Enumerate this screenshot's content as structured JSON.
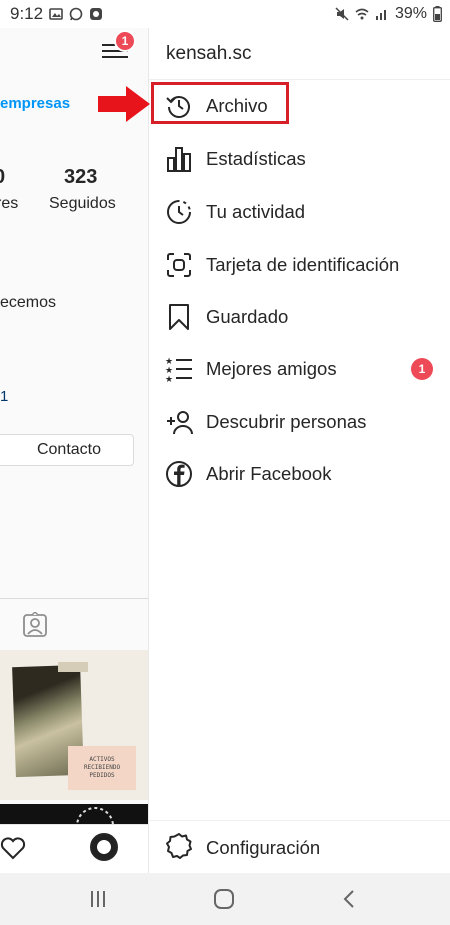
{
  "status_bar": {
    "time": "9:12",
    "battery": "39%",
    "left_icons": [
      "gallery-icon",
      "whatsapp-icon",
      "camera-app-icon"
    ],
    "right_icons": [
      "mute-icon",
      "wifi-icon",
      "signal-icon",
      "battery-icon"
    ]
  },
  "profile_bg": {
    "notification_count": "1",
    "business_link": "empresas",
    "stats": [
      {
        "number": "0",
        "label": "res"
      },
      {
        "number": "323",
        "label": "Seguidos"
      }
    ],
    "bio_fragment": "ecemos",
    "link_fragment": "1",
    "contact_button": "Contacto",
    "post_card_lines": [
      "ACTIVOS",
      "RECIBIENDO",
      "PEDIDOS"
    ]
  },
  "drawer": {
    "username": "kensah.sc",
    "items": [
      {
        "label": "Archivo",
        "icon": "archive-icon",
        "highlighted": true
      },
      {
        "label": "Estadísticas",
        "icon": "insights-icon"
      },
      {
        "label": "Tu actividad",
        "icon": "activity-icon"
      },
      {
        "label": "Tarjeta de identificación",
        "icon": "nametag-icon"
      },
      {
        "label": "Guardado",
        "icon": "bookmark-icon"
      },
      {
        "label": "Mejores amigos",
        "icon": "close-friends-icon",
        "badge": "1"
      },
      {
        "label": "Descubrir personas",
        "icon": "add-person-icon"
      },
      {
        "label": "Abrir Facebook",
        "icon": "facebook-icon"
      }
    ],
    "footer_label": "Configuración",
    "footer_icon": "settings-icon"
  },
  "nav_bar": {
    "buttons": [
      "recent-apps-icon",
      "home-icon",
      "back-icon"
    ]
  },
  "colors": {
    "badge": "#ed4956",
    "highlight": "#d61f27",
    "arrow": "#e8141c",
    "link_blue": "#0095f6"
  }
}
